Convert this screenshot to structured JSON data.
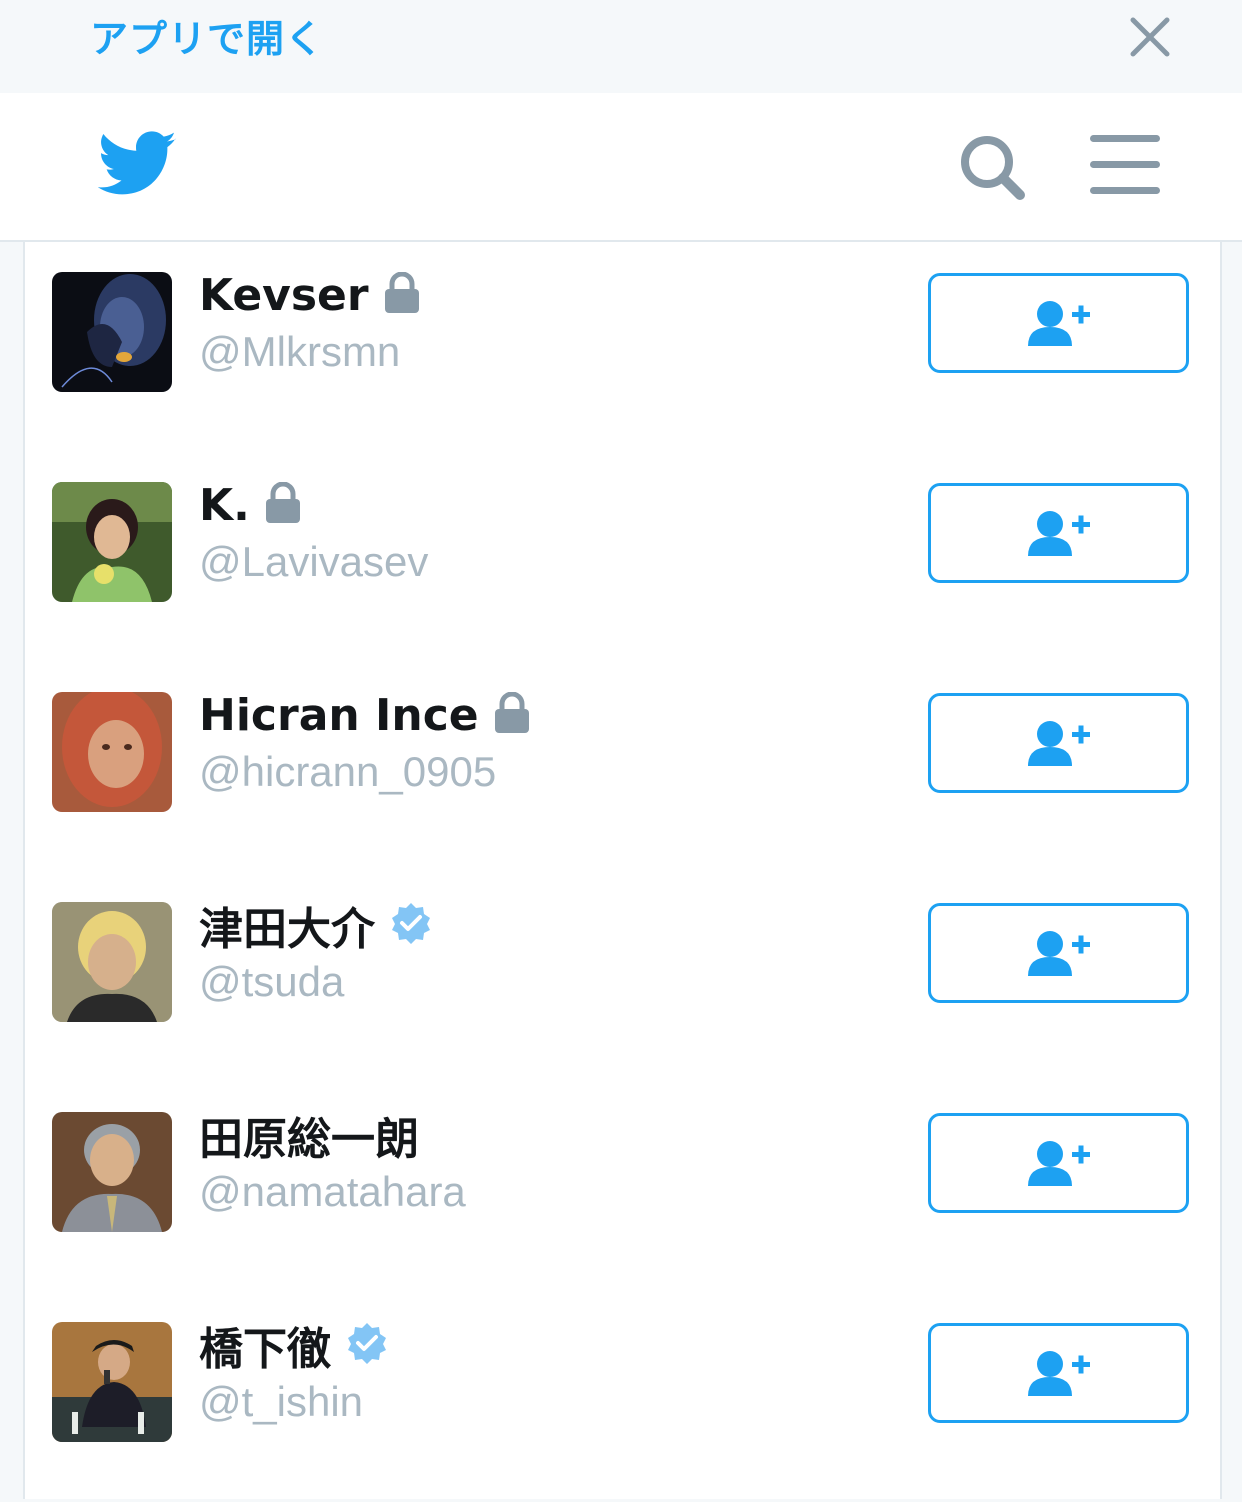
{
  "banner": {
    "open_in_app_label": "アプリで開く"
  },
  "header": {
    "logo_icon": "twitter-bird-icon",
    "search_icon": "search-icon",
    "menu_icon": "hamburger-menu-icon"
  },
  "colors": {
    "brand": "#1da1f2",
    "text": "#14171a",
    "muted": "#aab8c2",
    "lock": "#8899a6",
    "verified": "#83c5f5"
  },
  "users": [
    {
      "name": "Kevser",
      "handle": "@Mlkrsmn",
      "badge": "lock"
    },
    {
      "name": "K.",
      "handle": "@Lavivasev",
      "badge": "lock"
    },
    {
      "name": "Hicran Ince",
      "handle": "@hicrann_0905",
      "badge": "lock"
    },
    {
      "name": "津田大介",
      "handle": "@tsuda",
      "badge": "verified"
    },
    {
      "name": "田原総一朗",
      "handle": "@namatahara",
      "badge": "none"
    },
    {
      "name": "橋下徹",
      "handle": "@t_ishin",
      "badge": "verified"
    }
  ],
  "follow_button_icon": "add-user-icon"
}
